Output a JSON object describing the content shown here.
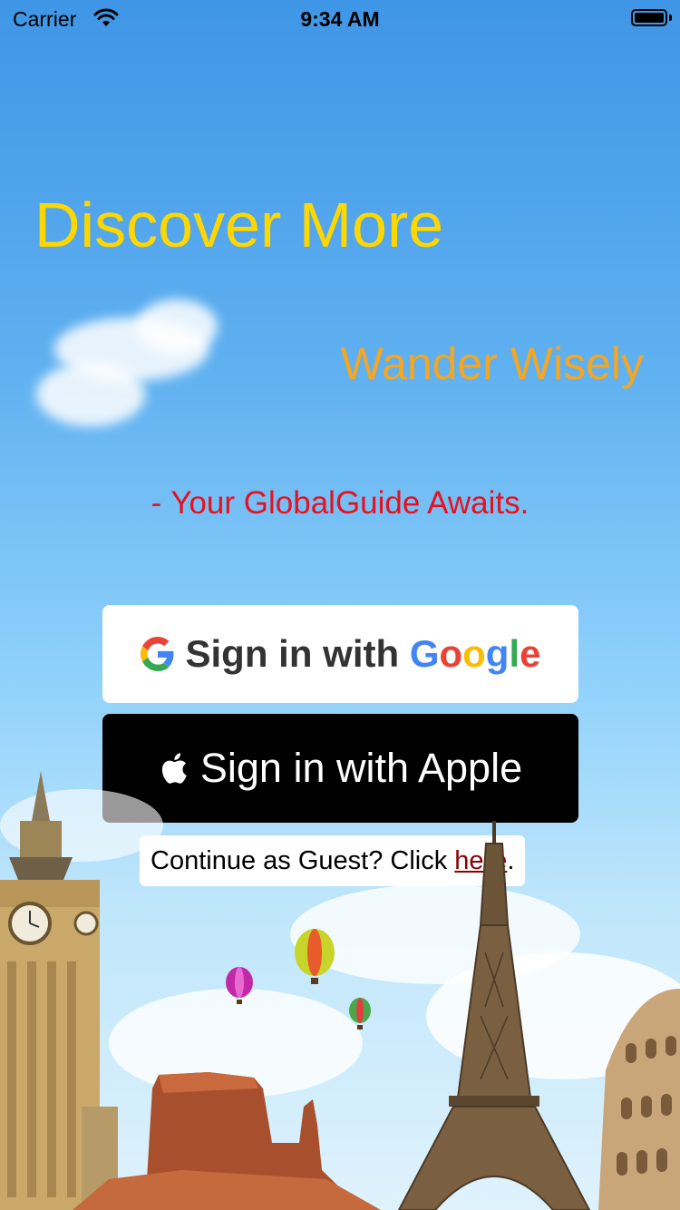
{
  "status_bar": {
    "carrier": "Carrier",
    "time": "9:34 AM"
  },
  "hero": {
    "headline": "Discover More",
    "subheadline": "Wander Wisely",
    "tagline_dash": "-",
    "tagline": "Your GlobalGuide Awaits.",
    "colors": {
      "headline": "#ffd700",
      "subheadline": "#f5a623",
      "tagline": "#e8101f"
    }
  },
  "auth": {
    "google_prefix": "Sign in with",
    "google_word": [
      "G",
      "o",
      "o",
      "g",
      "l",
      "e"
    ],
    "google_colors": [
      "#4285F4",
      "#EA4335",
      "#FBBC05",
      "#4285F4",
      "#34A853",
      "#EA4335"
    ],
    "apple_label": "Sign in with Apple",
    "guest_prefix": "Continue as Guest? Click",
    "guest_link": "here",
    "guest_suffix": "."
  },
  "icons": {
    "wifi": "wifi-icon",
    "battery": "battery-icon",
    "google": "google-g-icon",
    "apple": "apple-logo-icon"
  }
}
